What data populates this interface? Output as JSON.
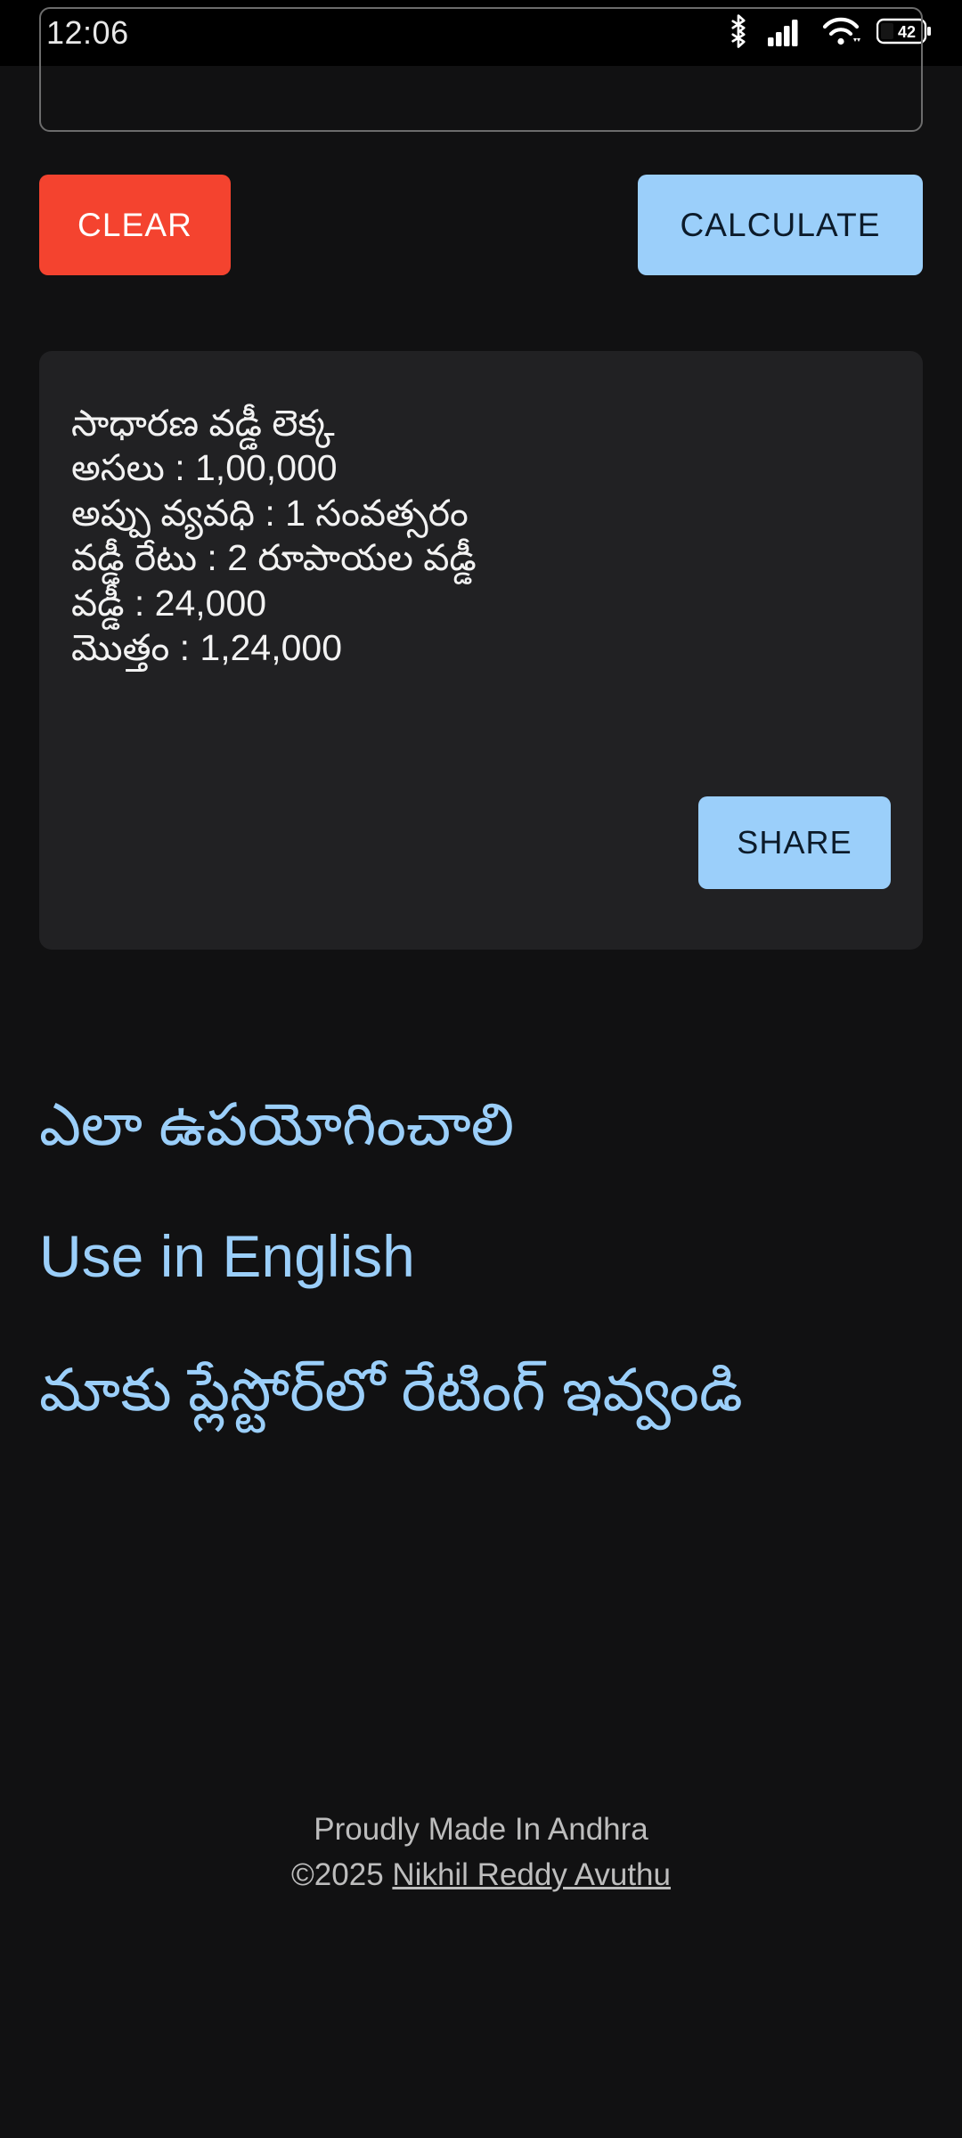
{
  "status_bar": {
    "clock": "12:06",
    "battery_percent": "42",
    "icons": [
      "bluetooth-icon",
      "cellular-signal-icon",
      "wifi-icon",
      "battery-icon"
    ]
  },
  "form": {
    "amount_value": "",
    "amount_placeholder": ""
  },
  "buttons": {
    "clear_label": "CLEAR",
    "calculate_label": "CALCULATE",
    "share_label": "SHARE"
  },
  "result_card": {
    "title": "సాధారణ వడ్డీ లెక్క",
    "lines": [
      "అసలు : 1,00,000",
      "అప్పు వ్యవధి : 1 సంవత్సరం",
      "వడ్డీ రేటు : 2 రూపాయల వడ్డీ",
      "వడ్డీ : 24,000",
      "మొత్తం : 1,24,000"
    ],
    "principal": "1,00,000",
    "duration": "1 సంవత్సరం",
    "rate": "2 రూపాయల వడ్డీ",
    "interest": "24,000",
    "total": "1,24,000"
  },
  "links": {
    "how_to_use": "ఎలా ఉపయోగించాలి",
    "use_in_english": "Use in English",
    "rate_playstore": "మాకు ప్లేస్టోర్‌లో రేటింగ్ ఇవ్వండి"
  },
  "footer": {
    "made_in": "Proudly Made In Andhra",
    "copyright_prefix": "©2025 ",
    "author": "Nikhil Reddy Avuthu"
  },
  "colors": {
    "page_background": "#111112",
    "card_background": "#212123",
    "accent_blue": "#9bcffa",
    "danger_red": "#f4432f",
    "text_primary": "#f2f2f2",
    "text_muted": "#bdbdbd"
  }
}
